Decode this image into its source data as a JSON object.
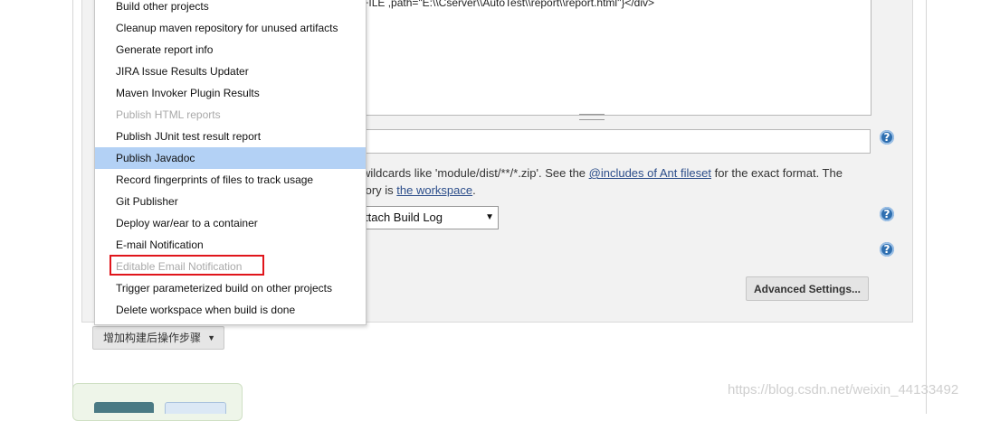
{
  "editor": {
    "code_line": "/>${FILE ,path=\"E:\\\\Cserver\\\\AutoTest\\\\report\\\\report.html\"}</div>"
  },
  "files_field": {
    "value": ""
  },
  "description": {
    "line1_prefix": "wildcards like 'module/dist/**/*.zip'. See the ",
    "line1_link": "@includes of Ant fileset",
    "line1_suffix": " for the exact format. The",
    "line2_prefix": "tory is ",
    "line2_link": "the workspace",
    "line2_suffix": "."
  },
  "select": {
    "value": "ttach Build Log"
  },
  "help_icon_glyph": "?",
  "advanced_button": {
    "label": "Advanced Settings..."
  },
  "add_step_button": {
    "label": "增加构建后操作步骤"
  },
  "dropdown": {
    "items": [
      {
        "label": "Build other projects",
        "state": "normal"
      },
      {
        "label": "Cleanup maven repository for unused artifacts",
        "state": "normal"
      },
      {
        "label": "Generate report info",
        "state": "normal"
      },
      {
        "label": "JIRA Issue Results Updater",
        "state": "normal"
      },
      {
        "label": "Maven Invoker Plugin Results",
        "state": "normal"
      },
      {
        "label": "Publish HTML reports",
        "state": "disabled"
      },
      {
        "label": "Publish JUnit test result report",
        "state": "normal"
      },
      {
        "label": "Publish Javadoc",
        "state": "selected"
      },
      {
        "label": "Record fingerprints of files to track usage",
        "state": "normal"
      },
      {
        "label": "Git Publisher",
        "state": "normal"
      },
      {
        "label": "Deploy war/ear to a container",
        "state": "normal"
      },
      {
        "label": "E-mail Notification",
        "state": "normal"
      },
      {
        "label": "Editable Email Notification",
        "state": "disabled"
      },
      {
        "label": "Trigger parameterized build on other projects",
        "state": "normal"
      },
      {
        "label": "Delete workspace when build is done",
        "state": "normal"
      }
    ]
  },
  "watermark": "https://blog.csdn.net/weixin_44133492",
  "colors": {
    "selected_bg": "#b3d1f5",
    "highlight_border": "#e0151b",
    "help_icon": "#2f6fb0",
    "link": "#2b4d8a"
  }
}
